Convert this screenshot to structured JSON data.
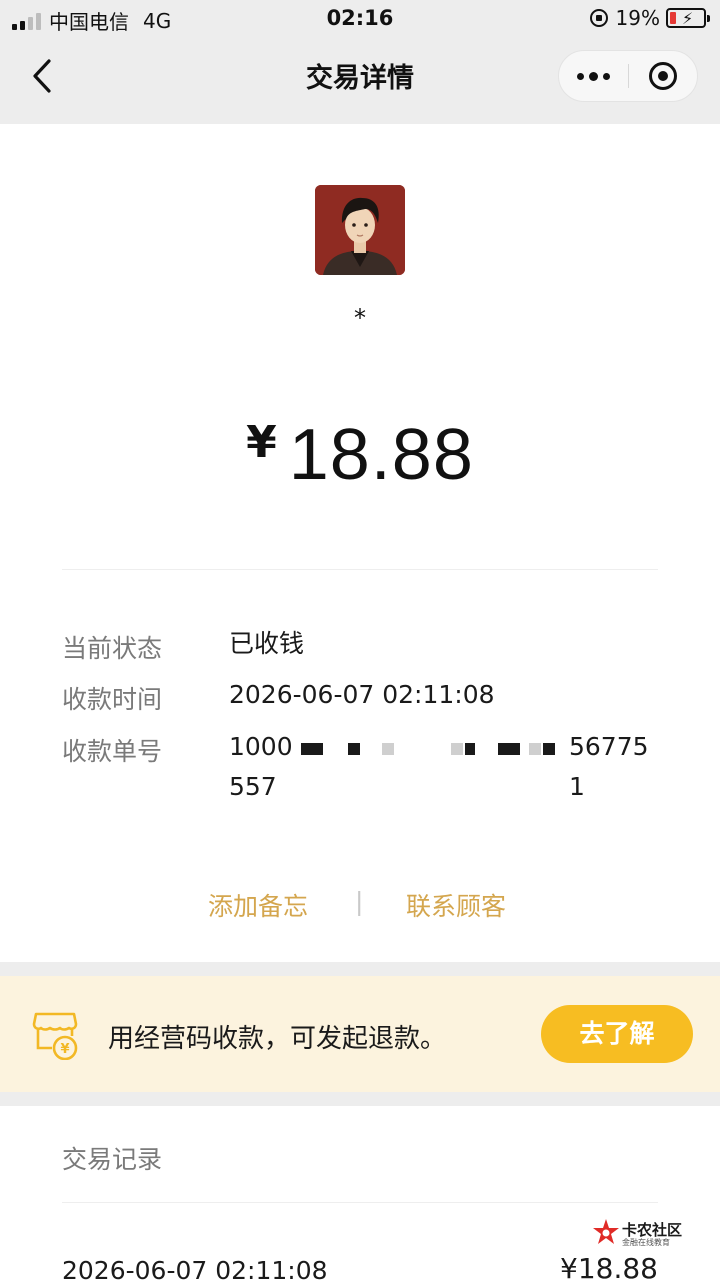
{
  "status_bar": {
    "carrier": "中国电信",
    "network": "4G",
    "time": "02:16",
    "battery_percent": "19%",
    "battery_level": 0.19
  },
  "nav": {
    "title": "交易详情"
  },
  "payer": {
    "name": "*"
  },
  "amount": {
    "currency_symbol": "¥",
    "value": "18.88"
  },
  "details": {
    "status_label": "当前状态",
    "status_value": "已收钱",
    "time_label": "收款时间",
    "time_value": "2026-06-07 02:11:08",
    "order_label": "收款单号",
    "order_value_prefix": "1000",
    "order_value_suffix": "567751",
    "order_value_line2": "557"
  },
  "actions": {
    "add_note": "添加备忘",
    "separator": "|",
    "contact_customer": "联系顾客"
  },
  "promo": {
    "text": "用经营码收款，可发起退款。",
    "button": "去了解",
    "icon_glyph": "¥",
    "accent_color": "#f7bd22"
  },
  "records": {
    "title": "交易记录",
    "items": [
      {
        "time": "2026-06-07 02:11:08",
        "amount": "¥18.88"
      }
    ]
  },
  "watermark": {
    "main": "卡农社区",
    "sub": "金融在线教育"
  }
}
